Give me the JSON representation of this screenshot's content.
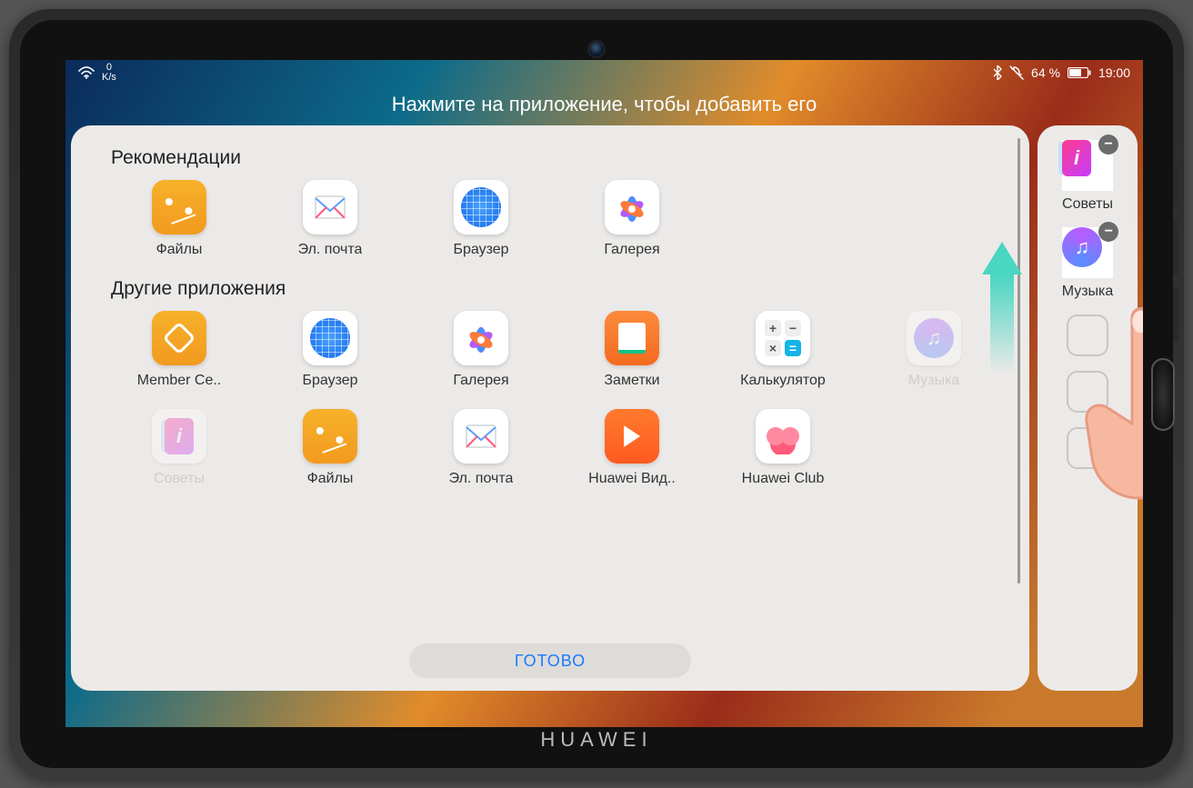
{
  "brand": "HUAWEI",
  "statusbar": {
    "speed_value": "0",
    "speed_unit": "K/s",
    "battery_percent": "64 %",
    "time": "19:00"
  },
  "instruction": "Нажмите на приложение, чтобы добавить его",
  "sections": {
    "recommendations_title": "Рекомендации",
    "others_title": "Другие приложения"
  },
  "recommendations": [
    {
      "id": "files",
      "label": "Файлы",
      "icon": "files"
    },
    {
      "id": "mail",
      "label": "Эл. почта",
      "icon": "mail"
    },
    {
      "id": "browser",
      "label": "Браузер",
      "icon": "browser"
    },
    {
      "id": "gallery",
      "label": "Галерея",
      "icon": "gallery"
    }
  ],
  "others": [
    {
      "id": "member",
      "label": "Member Ce..",
      "icon": "member"
    },
    {
      "id": "browser2",
      "label": "Браузер",
      "icon": "browser"
    },
    {
      "id": "gallery2",
      "label": "Галерея",
      "icon": "gallery"
    },
    {
      "id": "notes",
      "label": "Заметки",
      "icon": "notes"
    },
    {
      "id": "calc",
      "label": "Калькулятор",
      "icon": "calc"
    },
    {
      "id": "music",
      "label": "Музыка",
      "icon": "music",
      "ghost": true
    },
    {
      "id": "tips",
      "label": "Советы",
      "icon": "tips",
      "ghost": true
    },
    {
      "id": "files2",
      "label": "Файлы",
      "icon": "files"
    },
    {
      "id": "mail2",
      "label": "Эл. почта",
      "icon": "mail"
    },
    {
      "id": "video",
      "label": "Huawei Вид..",
      "icon": "video"
    },
    {
      "id": "club",
      "label": "Huawei Club",
      "icon": "club"
    }
  ],
  "done_label": "ГОТОВО",
  "dock": [
    {
      "id": "dock-tips",
      "label": "Советы",
      "icon": "tips",
      "removable": true
    },
    {
      "id": "dock-music",
      "label": "Музыка",
      "icon": "music",
      "removable": true
    }
  ],
  "empty_dock_slots": 3
}
